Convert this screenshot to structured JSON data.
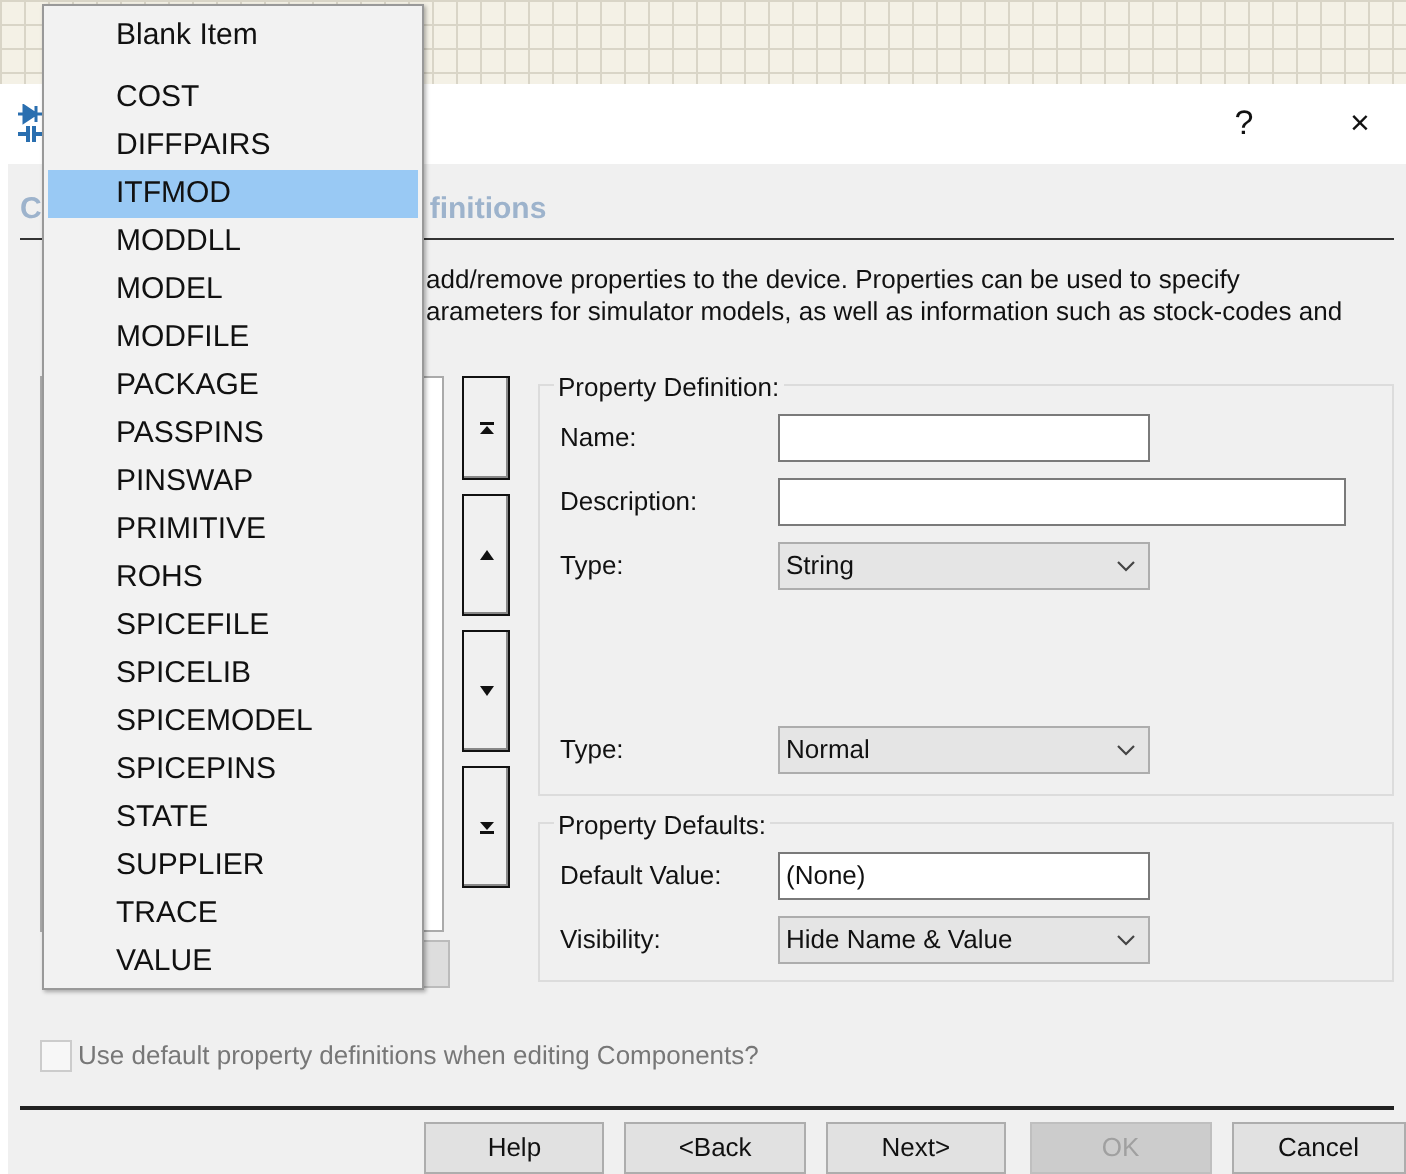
{
  "title_bar": {
    "buttons": [
      "?",
      "×"
    ]
  },
  "heading_fragments": [
    "C",
    "finitions"
  ],
  "description_lines": [
    "add/remove properties to the device. Properties can be used to specify",
    "arameters for simulator models, as well as information such as stock-codes and"
  ],
  "move_buttons": [
    {
      "kind": "top"
    },
    {
      "kind": "up"
    },
    {
      "kind": "down"
    },
    {
      "kind": "bottom"
    }
  ],
  "property_definition": {
    "title": "Property Definition:",
    "fields": [
      {
        "kind": "text",
        "label": "Name:"
      },
      {
        "kind": "text",
        "label": "Description:"
      },
      {
        "kind": "select",
        "label": "Type:",
        "value": "String"
      },
      {
        "kind": "select",
        "label": "Type:",
        "value": "Normal"
      }
    ]
  },
  "property_defaults": {
    "title": "Property Defaults:",
    "fields": [
      {
        "kind": "text",
        "label": "Default Value:",
        "value": "(None)"
      },
      {
        "kind": "select",
        "label": "Visibility:",
        "value": "Hide Name & Value"
      }
    ]
  },
  "option": {
    "label": "Use default property definitions when editing Components?",
    "checked": false,
    "disabled": true
  },
  "buttons": [
    {
      "label": "Help",
      "disabled": false
    },
    {
      "label": "<Back",
      "disabled": false
    },
    {
      "label": "Next>",
      "disabled": false
    },
    {
      "label": "OK",
      "disabled": true
    },
    {
      "label": "Cancel",
      "disabled": false
    }
  ],
  "dropdown": {
    "items": [
      {
        "label": "Blank Item",
        "selected": false
      },
      {
        "label": "COST",
        "selected": false
      },
      {
        "label": "DIFFPAIRS",
        "selected": false
      },
      {
        "label": "ITFMOD",
        "selected": true
      },
      {
        "label": "MODDLL",
        "selected": false
      },
      {
        "label": "MODEL",
        "selected": false
      },
      {
        "label": "MODFILE",
        "selected": false
      },
      {
        "label": "PACKAGE",
        "selected": false
      },
      {
        "label": "PASSPINS",
        "selected": false
      },
      {
        "label": "PINSWAP",
        "selected": false
      },
      {
        "label": "PRIMITIVE",
        "selected": false
      },
      {
        "label": "ROHS",
        "selected": false
      },
      {
        "label": "SPICEFILE",
        "selected": false
      },
      {
        "label": "SPICELIB",
        "selected": false
      },
      {
        "label": "SPICEMODEL",
        "selected": false
      },
      {
        "label": "SPICEPINS",
        "selected": false
      },
      {
        "label": "STATE",
        "selected": false
      },
      {
        "label": "SUPPLIER",
        "selected": false
      },
      {
        "label": "TRACE",
        "selected": false
      },
      {
        "label": "VALUE",
        "selected": false
      }
    ]
  }
}
